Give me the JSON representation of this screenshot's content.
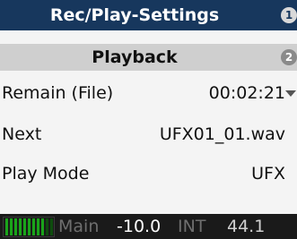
{
  "window": {
    "title": "Rec/Play-Settings",
    "page_badge": "1"
  },
  "section": {
    "title": "Playback",
    "page_badge": "2"
  },
  "settings": [
    {
      "label": "Remain (File)",
      "value": "00:02:21"
    },
    {
      "label": "Next",
      "value": "UFX01_01.wav"
    },
    {
      "label": "Play Mode",
      "value": "UFX"
    }
  ],
  "status": {
    "meter_level": 0.8,
    "mix": "Main",
    "level": "-10.0",
    "clock": "INT",
    "sample_rate": "44.1"
  },
  "colors": {
    "titlebar": "#17375d",
    "subbar": "#cfcfcf",
    "statusbar": "#1a1a1a",
    "meter": "#1aa31a"
  },
  "icons": {
    "scroll": "chevron-down-icon"
  }
}
